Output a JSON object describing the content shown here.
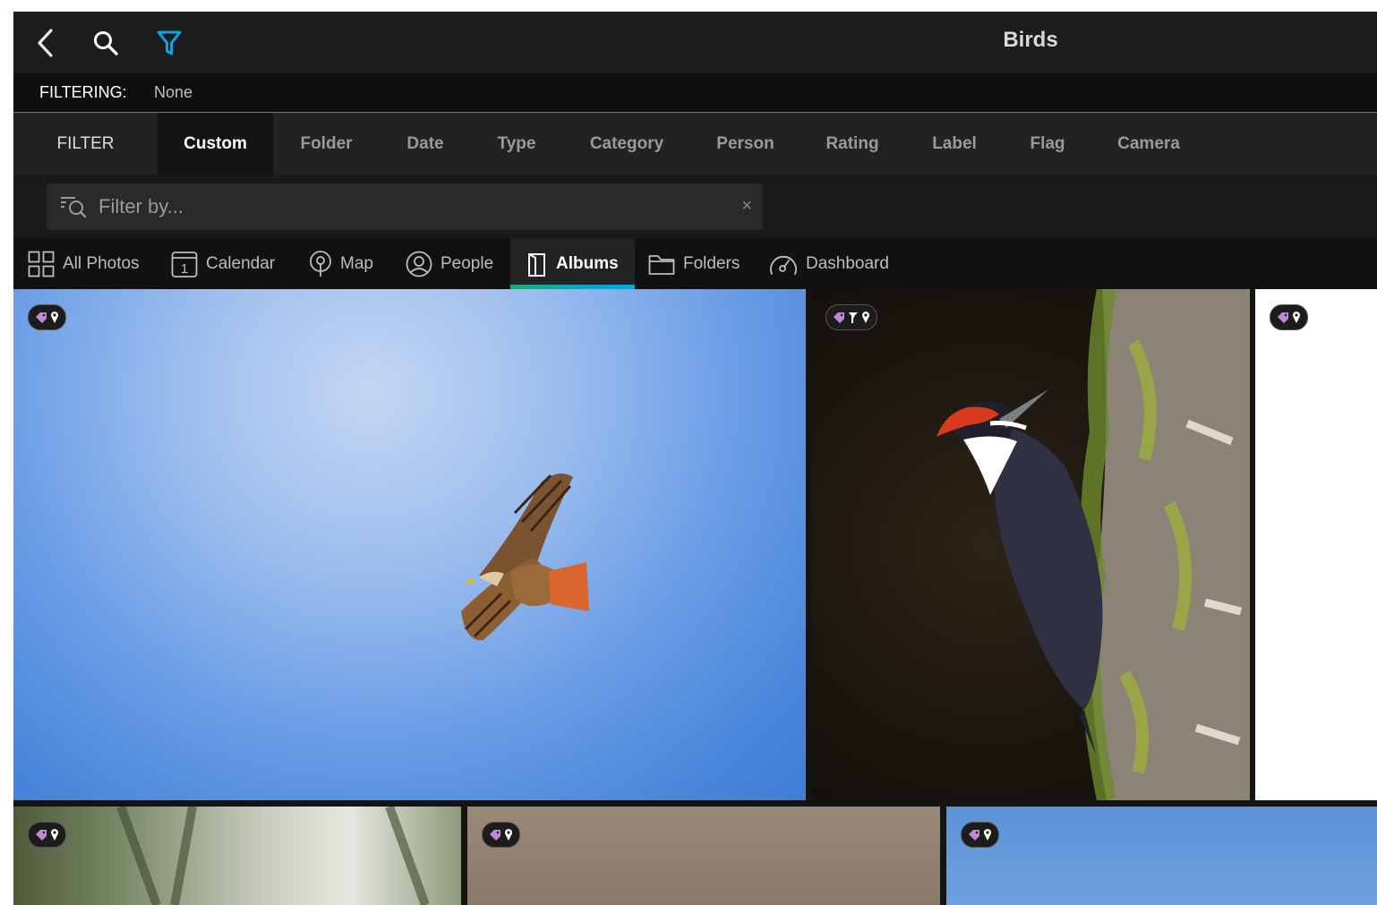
{
  "header": {
    "title": "Birds"
  },
  "filtering": {
    "label": "FILTERING:",
    "value": "None"
  },
  "filter_tabs": {
    "filter_label": "FILTER",
    "items": [
      "Custom",
      "Folder",
      "Date",
      "Type",
      "Category",
      "Person",
      "Rating",
      "Label",
      "Flag",
      "Camera"
    ],
    "active": "Custom"
  },
  "search": {
    "placeholder": "Filter by...",
    "clear_glyph": "×"
  },
  "nav": {
    "items": [
      "All Photos",
      "Calendar",
      "Map",
      "People",
      "Albums",
      "Folders",
      "Dashboard"
    ],
    "active": "Albums",
    "calendar_day": "1"
  },
  "photos": [
    {
      "subject": "Hawk in flight",
      "badges": [
        "tag-icon",
        "pin-icon"
      ]
    },
    {
      "subject": "Woodpecker on trunk",
      "badges": [
        "tag-icon",
        "flag-icon",
        "pin-icon"
      ]
    },
    {
      "subject": "White image",
      "badges": [
        "tag-icon",
        "pin-icon"
      ]
    },
    {
      "subject": "Pine branch",
      "badges": [
        "tag-icon",
        "pin-icon"
      ]
    },
    {
      "subject": "Blurred brown",
      "badges": [
        "tag-icon",
        "pin-icon"
      ]
    },
    {
      "subject": "Sky",
      "badges": [
        "tag-icon",
        "pin-icon"
      ]
    }
  ],
  "colors": {
    "accent_filter": "#0aa4e8",
    "tag_purple": "#c28ad6",
    "tab_underline": "#1ea57c"
  }
}
